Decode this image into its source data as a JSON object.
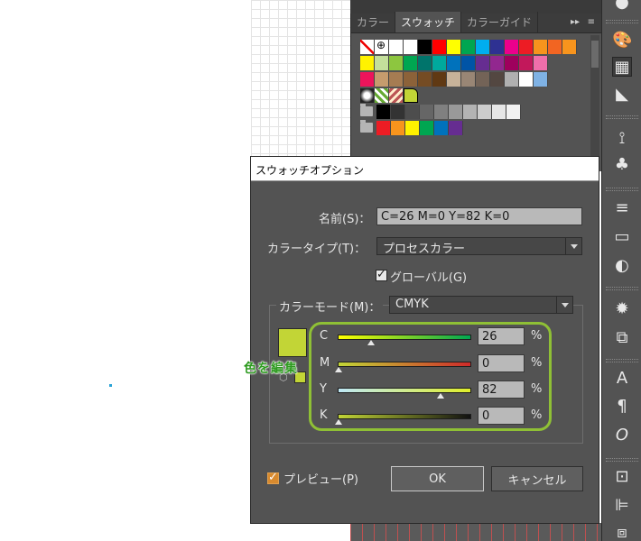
{
  "panel": {
    "tabs": [
      {
        "label": "カラー"
      },
      {
        "label": "スウォッチ"
      },
      {
        "label": "カラーガイド"
      }
    ],
    "menu_glyph": "▸▸",
    "flyout_glyph": "≡"
  },
  "swatches": {
    "row1": [
      "#ffffff",
      "#ffffff",
      "#000000",
      "#ff0000",
      "#ffff00",
      "#00a651",
      "#00aeef",
      "#2e3192",
      "#ec008c",
      "#ed1c24",
      "#f7941d",
      "#f26522",
      "#f7941d"
    ],
    "row2": [
      "#fff200",
      "#c4df9b",
      "#8dc63f",
      "#00a651",
      "#00746b",
      "#00a99d",
      "#0072bc",
      "#0054a6",
      "#662d91",
      "#92278f",
      "#9e005d",
      "#c2185b",
      "#f06eaa"
    ],
    "row3": [
      "#ed145b",
      "#c69c6d",
      "#a67c52",
      "#8c6239",
      "#754c24",
      "#603913",
      "#c7b299",
      "#998675",
      "#736357",
      "#534741",
      "#b0b0b0",
      "#ffffff",
      "#7fb2e5"
    ],
    "row5": [
      "#000000",
      "#333333",
      "#4d4d4d",
      "#666666",
      "#808080",
      "#999999",
      "#b3b3b3",
      "#cccccc",
      "#e6e6e6",
      "#f2f2f2"
    ],
    "row6": [
      "#ed1c24",
      "#f7941d",
      "#fff200",
      "#00a651",
      "#0072bc",
      "#662d91"
    ]
  },
  "dialog": {
    "title": "スウォッチオプション",
    "name_label": "名前(S)：",
    "name_value": "C=26 M=0 Y=82 K=0",
    "color_type_label": "カラータイプ(T)：",
    "color_type_value": "プロセスカラー",
    "global_label": "グローバル(G)",
    "color_mode_label": "カラーモード(M)：",
    "color_mode_value": "CMYK",
    "channels": [
      {
        "name": "C",
        "value": "26",
        "unit": "%",
        "fraction": 0.26
      },
      {
        "name": "M",
        "value": "0",
        "unit": "%",
        "fraction": 0.0
      },
      {
        "name": "Y",
        "value": "82",
        "unit": "%",
        "fraction": 0.82
      },
      {
        "name": "K",
        "value": "0",
        "unit": "%",
        "fraction": 0.0
      }
    ],
    "preview_label": "プレビュー(P)",
    "ok_label": "OK",
    "cancel_label": "キャンセル",
    "swatch_color": "#c2d536"
  },
  "annotation": {
    "text": "色を編集"
  },
  "colors": {
    "highlight": "#8fc035",
    "panel_bg": "#535353"
  }
}
